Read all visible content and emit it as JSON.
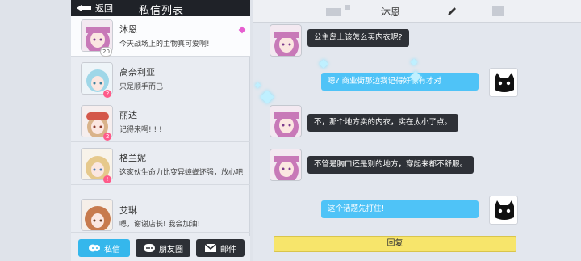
{
  "header": {
    "back_label": "返回",
    "list_title": "私信列表",
    "chat_title": "沐恩"
  },
  "contacts": [
    {
      "name": "沐恩",
      "message": "今天战场上的主物真可爱啊!",
      "badge": "20",
      "badge_color": "#ffffff",
      "avatar_hair": "#c879b8"
    },
    {
      "name": "高奈利亚",
      "message": "只是顺手而已",
      "badge": "2",
      "badge_color": "#ff5b8a",
      "avatar_hair": "#9fd7e8"
    },
    {
      "name": "丽达",
      "message": "记得来啊! ! !",
      "badge": "2",
      "badge_color": "#ff5b8a",
      "avatar_hair": "#d4574a"
    },
    {
      "name": "格兰妮",
      "message": "这家伙生命力比变异蟑螂还强，放心吧",
      "badge": "!",
      "badge_color": "#ff5b8a",
      "avatar_hair": "#e6c98c"
    },
    {
      "name": "艾琳",
      "message": "嗯，谢谢店长! 我会加油!",
      "badge": "",
      "badge_color": "",
      "avatar_hair": "#c77a4d"
    }
  ],
  "tabs": [
    {
      "label": "私信",
      "icon": "chat-icon"
    },
    {
      "label": "朋友圈",
      "icon": "moments-icon"
    },
    {
      "label": "邮件",
      "icon": "mail-icon"
    }
  ],
  "messages": [
    {
      "side": "in",
      "text": "公主岛上该怎么买内衣呢?"
    },
    {
      "side": "out",
      "text": "嗯? 商业街那边我记得好像有才对"
    },
    {
      "side": "in",
      "text": "不，那个地方卖的内衣，实在太小了点。"
    },
    {
      "side": "in",
      "text": "不管是胸口还是别的地方，穿起来都不舒服。"
    },
    {
      "side": "out",
      "text": "这个话题先打住!"
    }
  ],
  "reply_label": "回复",
  "colors": {
    "accent_blue": "#35b7ec",
    "reply_yellow": "#f7e56b",
    "dark_bar": "#1f2228"
  }
}
